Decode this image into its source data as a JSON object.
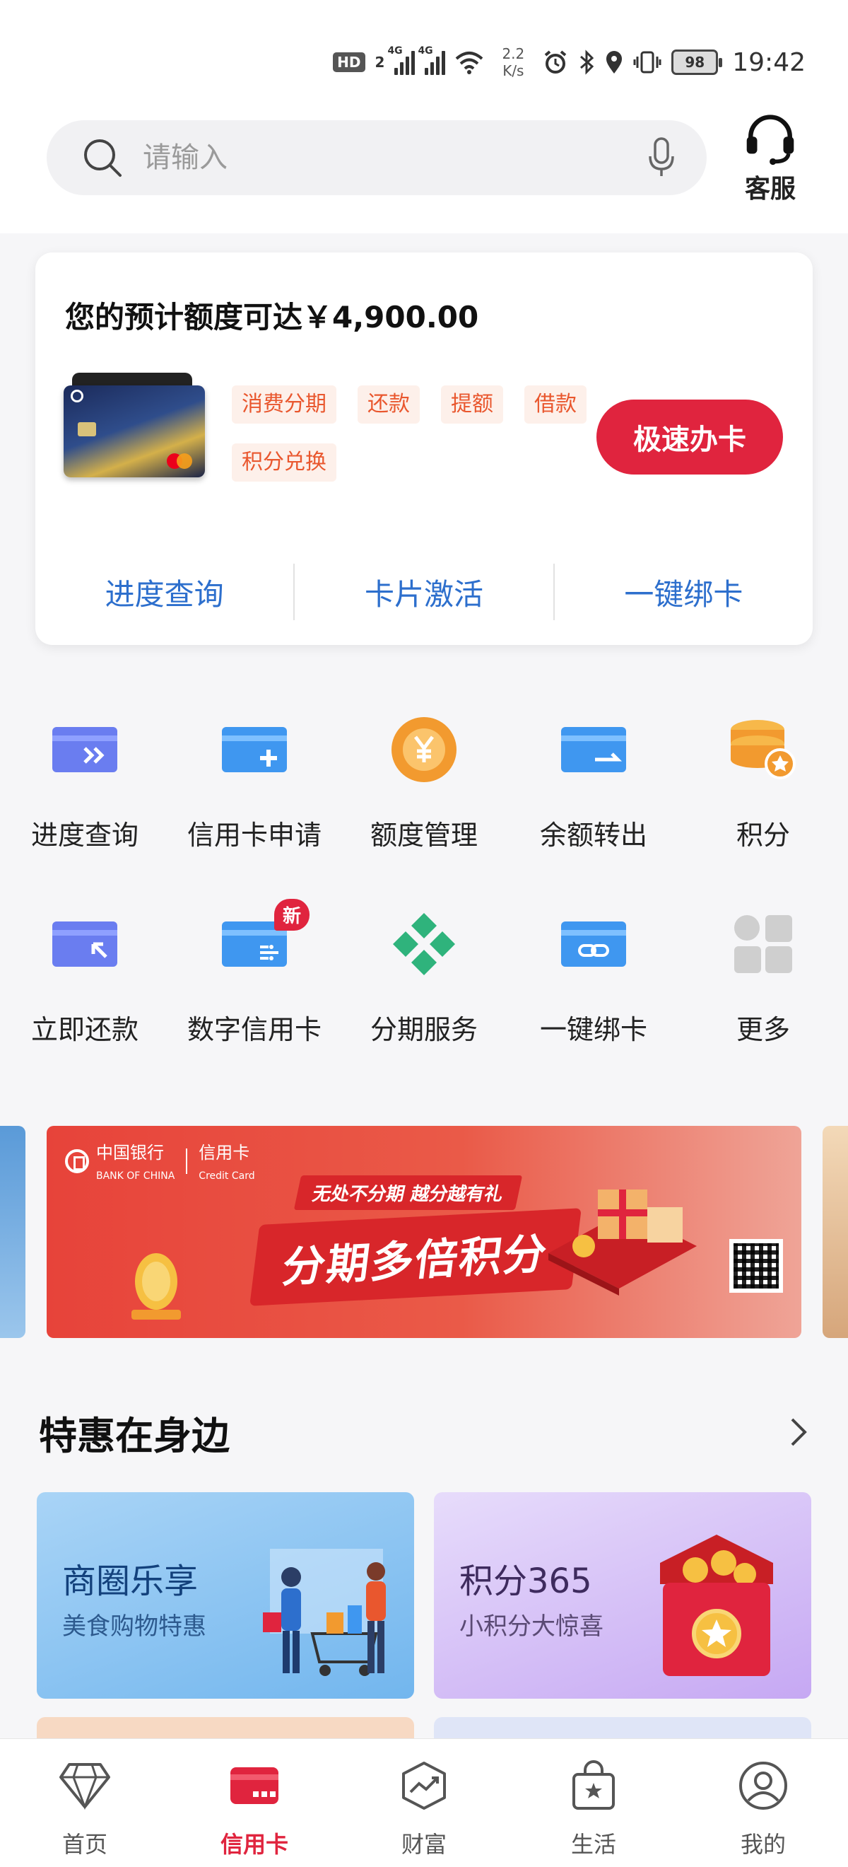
{
  "status_bar": {
    "hd": "HD",
    "sim": "2",
    "net1": "4G",
    "net2": "4G",
    "speed_value": "2.2",
    "speed_unit": "K/s",
    "battery": "98",
    "time": "19:42"
  },
  "search": {
    "placeholder": "请输入",
    "service_label": "客服"
  },
  "card_panel": {
    "limit_text": "您的预计额度可达￥4,900.00",
    "tags": [
      "消费分期",
      "还款",
      "提额",
      "借款",
      "积分兑换"
    ],
    "apply_button": "极速办卡",
    "quick_links": [
      "进度查询",
      "卡片激活",
      "一键绑卡"
    ]
  },
  "grid": {
    "items": [
      {
        "label": "进度查询",
        "icon": "progress-card-icon"
      },
      {
        "label": "信用卡申请",
        "icon": "card-add-icon"
      },
      {
        "label": "额度管理",
        "icon": "yuan-coin-icon"
      },
      {
        "label": "余额转出",
        "icon": "card-transfer-icon"
      },
      {
        "label": "积分",
        "icon": "points-coins-icon"
      },
      {
        "label": "立即还款",
        "icon": "card-repay-icon"
      },
      {
        "label": "数字信用卡",
        "icon": "digital-card-icon",
        "badge": "新"
      },
      {
        "label": "分期服务",
        "icon": "installment-diamond-icon"
      },
      {
        "label": "一键绑卡",
        "icon": "card-link-icon"
      },
      {
        "label": "更多",
        "icon": "more-grid-icon"
      }
    ]
  },
  "banner": {
    "bank_name": "中国银行",
    "bank_name_en": "BANK OF CHINA",
    "card_label": "信用卡",
    "card_label_en": "Credit Card",
    "subtitle": "无处不分期 越分越有礼",
    "title": "分期多倍积分"
  },
  "section": {
    "title": "特惠在身边",
    "promos": [
      {
        "title": "商圈乐享",
        "subtitle": "美食购物特惠"
      },
      {
        "title": "积分365",
        "subtitle": "小积分大惊喜"
      }
    ]
  },
  "bottom_nav": {
    "items": [
      {
        "label": "首页",
        "icon": "diamond-icon"
      },
      {
        "label": "信用卡",
        "icon": "credit-card-icon",
        "active": true
      },
      {
        "label": "财富",
        "icon": "wealth-chart-icon"
      },
      {
        "label": "生活",
        "icon": "shopping-bag-icon"
      },
      {
        "label": "我的",
        "icon": "user-icon"
      }
    ]
  },
  "colors": {
    "brand_red": "#e0243e",
    "link_blue": "#2d6fcd",
    "tag_orange": "#e9572e"
  }
}
